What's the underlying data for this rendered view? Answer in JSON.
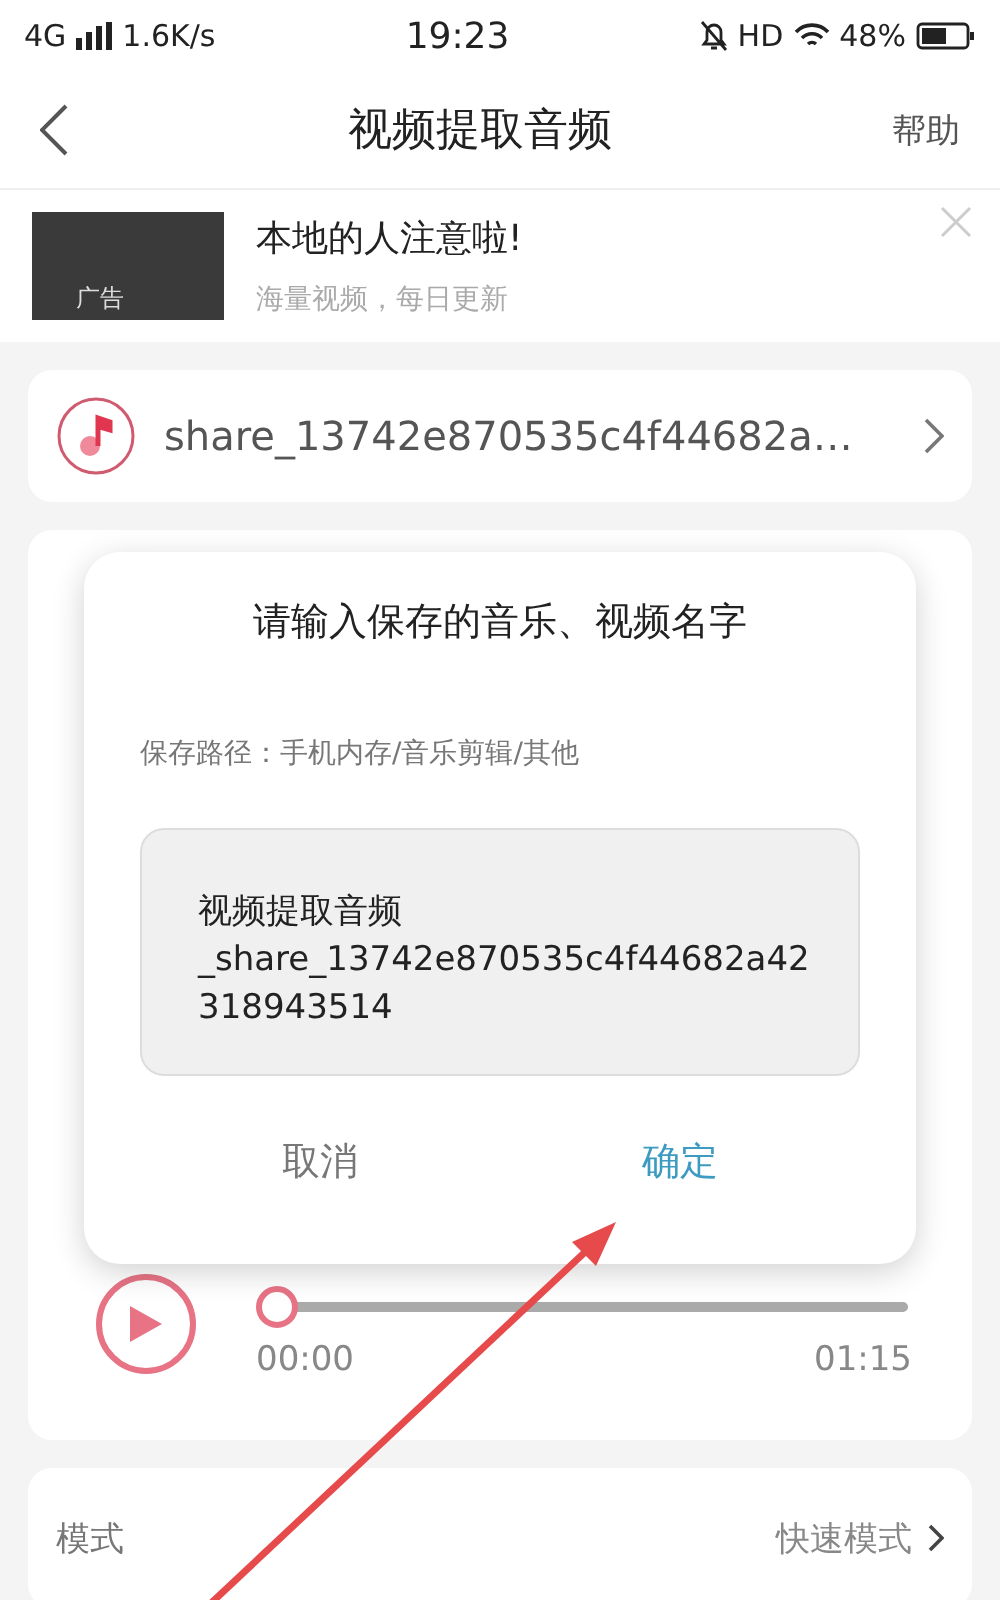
{
  "status_bar": {
    "network": "4G",
    "speed": "1.6K/s",
    "time": "19:23",
    "hd": "HD",
    "battery": "48%"
  },
  "nav": {
    "title": "视频提取音频",
    "action": "帮助"
  },
  "ad": {
    "title": "本地的人注意啦!",
    "subtitle": "海量视频，每日更新",
    "badge": "广告"
  },
  "file": {
    "name": "share_13742e870535c4f44682a…"
  },
  "player": {
    "level": 0,
    "current": "00:00",
    "total": "01:15"
  },
  "settings": [
    {
      "label": "模式",
      "value": "快速模式"
    }
  ],
  "dialog": {
    "title": "请输入保存的音乐、视频名字",
    "path": "保存路径：手机内存/音乐剪辑/其他",
    "value": "视频提取音频_share_13742e870535c4f44682a42318943514",
    "buttons": [
      {
        "label": "取消",
        "kind": "cancel"
      },
      {
        "label": "确定",
        "kind": "confirm"
      }
    ]
  }
}
